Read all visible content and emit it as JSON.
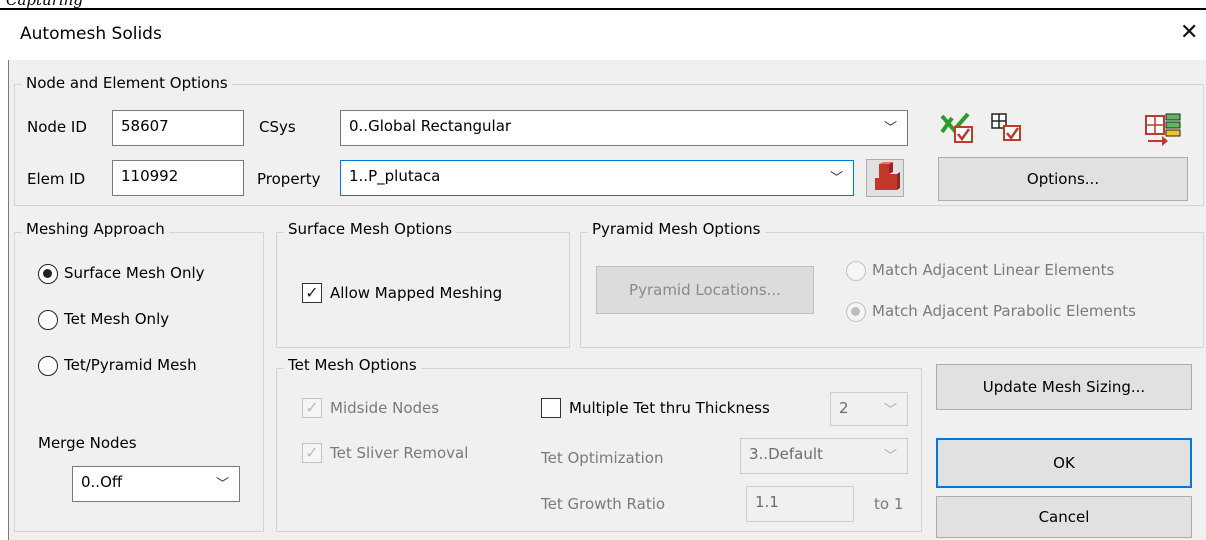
{
  "page_header": "Capturing",
  "window": {
    "title": "Automesh Solids",
    "close_glyph": "✕"
  },
  "node_element": {
    "legend": "Node and Element Options",
    "node_id_label": "Node ID",
    "node_id": "58607",
    "elem_id_label": "Elem ID",
    "elem_id": "110992",
    "csys_label": "CSys",
    "csys_value": "0..Global Rectangular",
    "property_label": "Property",
    "property_value": "1..P_plutaca",
    "options_button": "Options..."
  },
  "meshing_approach": {
    "legend": "Meshing Approach",
    "options": [
      "Surface Mesh Only",
      "Tet Mesh Only",
      "Tet/Pyramid Mesh"
    ],
    "selected": "Surface Mesh Only",
    "merge_label": "Merge Nodes",
    "merge_value": "0..Off"
  },
  "surface_mesh": {
    "legend": "Surface Mesh Options",
    "allow_mapped": "Allow Mapped Meshing",
    "allow_mapped_checked": true
  },
  "pyramid_mesh": {
    "legend": "Pyramid Mesh Options",
    "locations_button": "Pyramid Locations...",
    "match_linear": "Match Adjacent Linear Elements",
    "match_parabolic": "Match Adjacent Parabolic Elements",
    "selected": "Match Adjacent Parabolic Elements"
  },
  "tet_mesh": {
    "legend": "Tet Mesh Options",
    "midside": "Midside Nodes",
    "sliver": "Tet Sliver Removal",
    "multiple": "Multiple Tet thru Thickness",
    "multiple_value": "2",
    "optimization_label": "Tet Optimization",
    "optimization_value": "3..Default",
    "growth_label": "Tet Growth Ratio",
    "growth_value": "1.1",
    "growth_suffix": "to 1"
  },
  "actions": {
    "update_sizing": "Update Mesh Sizing...",
    "ok": "OK",
    "cancel": "Cancel"
  },
  "icons": {
    "check_all": "checklist-icon",
    "grid_check": "grid-check-icon",
    "grid_export": "grid-export-icon",
    "property_shape": "solid-shape-icon"
  }
}
